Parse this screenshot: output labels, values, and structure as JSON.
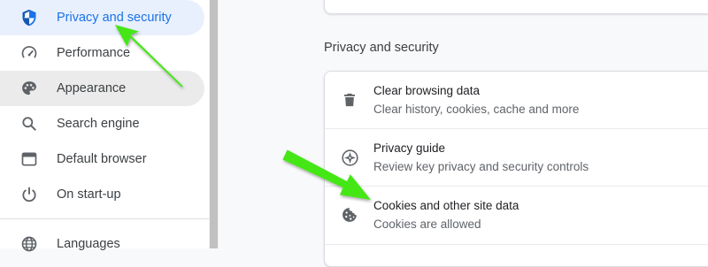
{
  "sidebar": {
    "items": [
      {
        "label": "Privacy and security",
        "icon": "shield-icon",
        "state": "active"
      },
      {
        "label": "Performance",
        "icon": "speedometer-icon",
        "state": "normal"
      },
      {
        "label": "Appearance",
        "icon": "palette-icon",
        "state": "hover"
      },
      {
        "label": "Search engine",
        "icon": "search-icon",
        "state": "normal"
      },
      {
        "label": "Default browser",
        "icon": "browser-window-icon",
        "state": "normal"
      },
      {
        "label": "On start-up",
        "icon": "power-icon",
        "state": "normal"
      },
      {
        "label": "Languages",
        "icon": "globe-icon",
        "state": "normal"
      }
    ]
  },
  "main": {
    "section_title": "Privacy and security",
    "rows": [
      {
        "title": "Clear browsing data",
        "subtitle": "Clear history, cookies, cache and more",
        "icon": "trash-icon"
      },
      {
        "title": "Privacy guide",
        "subtitle": "Review key privacy and security controls",
        "icon": "compass-icon"
      },
      {
        "title": "Cookies and other site data",
        "subtitle": "Cookies are allowed",
        "icon": "cookie-icon"
      }
    ]
  },
  "colors": {
    "accent": "#1a73e8",
    "active_bg": "#e8f0fe",
    "hover_bg": "#ebebeb",
    "annotation_arrow": "#44e617"
  }
}
